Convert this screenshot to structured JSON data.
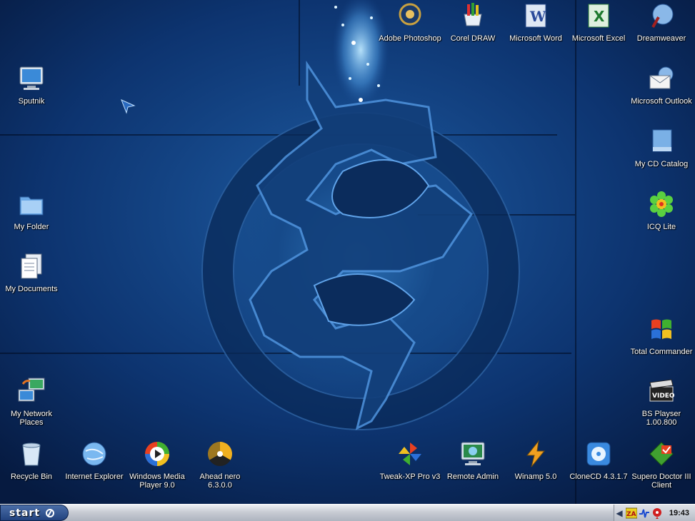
{
  "desktop": {
    "icons_left": [
      {
        "label": "Sputnik",
        "icon": "monitor-icon"
      },
      {
        "label": "My Folder",
        "icon": "folder-icon"
      },
      {
        "label": "My Documents",
        "icon": "documents-icon"
      },
      {
        "label": "My Network Places",
        "icon": "network-places-icon"
      }
    ],
    "icons_top": [
      {
        "label": "Adobe Photoshop",
        "icon": "photoshop-icon"
      },
      {
        "label": "Corel DRAW",
        "icon": "coreldraw-icon"
      },
      {
        "label": "Microsoft Word",
        "icon": "word-icon"
      },
      {
        "label": "Microsoft Excel",
        "icon": "excel-icon"
      },
      {
        "label": "Dreamweaver",
        "icon": "dreamweaver-icon"
      }
    ],
    "icons_right": [
      {
        "label": "Microsoft Outlook",
        "icon": "outlook-icon"
      },
      {
        "label": "My CD Catalog",
        "icon": "cd-catalog-icon"
      },
      {
        "label": "ICQ Lite",
        "icon": "icq-icon"
      },
      {
        "label": "Total Commander",
        "icon": "windows-flag-icon"
      },
      {
        "label": "BS Playser 1.00.800",
        "icon": "video-clapper-icon"
      }
    ],
    "icons_bottom": [
      {
        "label": "Recycle Bin",
        "icon": "recycle-bin-icon"
      },
      {
        "label": "Internet Explorer",
        "icon": "globe-icon"
      },
      {
        "label": "Windows Media Player 9.0",
        "icon": "media-player-icon"
      },
      {
        "label": "Ahead nero 6.3.0.0",
        "icon": "nero-icon"
      },
      {
        "label": "Tweak-XP Pro v3",
        "icon": "pinwheel-icon"
      },
      {
        "label": "Remote Admin",
        "icon": "remote-monitor-icon"
      },
      {
        "label": "Winamp 5.0",
        "icon": "winamp-icon"
      },
      {
        "label": "CloneCD 4.3.1.7",
        "icon": "clonecd-icon"
      },
      {
        "label": "Supero Doctor III Client",
        "icon": "supero-doctor-icon"
      }
    ]
  },
  "taskbar": {
    "start_label": "start",
    "tray_icons": [
      "zonealarm-icon",
      "network-activity-icon",
      "balloon-icon"
    ],
    "tray_zonealarm_text": "ZA",
    "clock": "19:43"
  },
  "colors": {
    "desktop_bg": "#0d3470",
    "accent_glow": "#7fd0ff",
    "taskbar": "#c8ccd4"
  }
}
